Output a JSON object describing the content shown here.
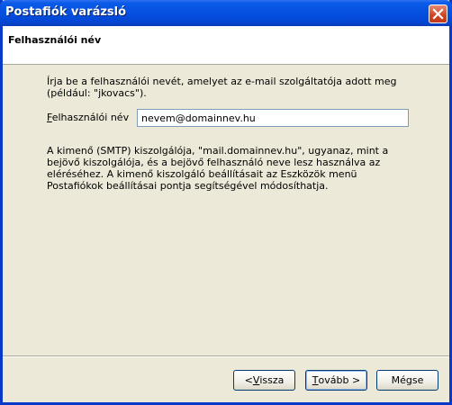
{
  "window": {
    "title": "Postafiók varázsló"
  },
  "header": {
    "title": "Felhasználói név"
  },
  "intro_text": "Írja be a felhasználói nevét, amelyet az e-mail szolgáltatója adott meg (például: \"jkovacs\").",
  "field": {
    "label_accel": "F",
    "label_rest": "elhasználói név",
    "value": "nevem@domainnev.hu"
  },
  "info_text": "A kimenő (SMTP) kiszolgálója, \"mail.domainnev.hu\", ugyanaz, mint a bejövő kiszolgálója, és a bejövő felhasználó neve lesz használva az eléréséhez. A kimenő kiszolgáló beállításait az Eszközök menü Postafiókok beállításai pontja segítségével módosíthatja.",
  "buttons": {
    "back_prefix": "< ",
    "back_accel": "V",
    "back_rest": "issza",
    "next_accel": "T",
    "next_rest": "ovább >",
    "cancel": "Mégse"
  }
}
